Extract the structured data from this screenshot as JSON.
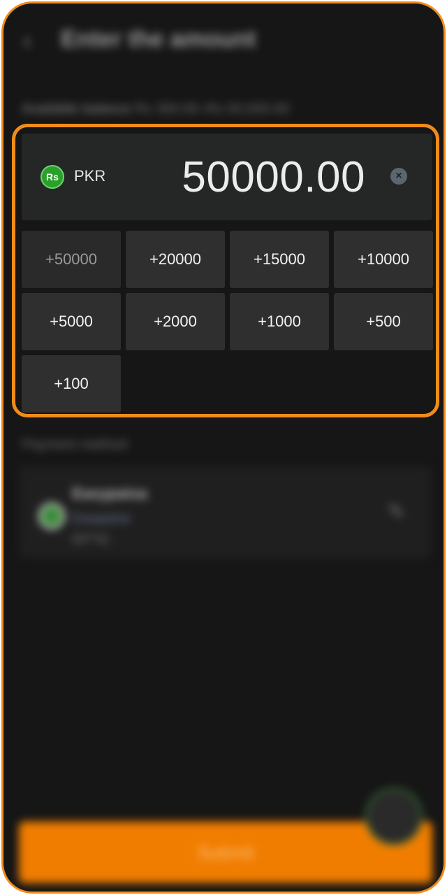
{
  "header": {
    "title": "Enter the amount"
  },
  "balance": {
    "label": "Available balance",
    "value": "Rs 300.00–Rs 50,000.00"
  },
  "amount": {
    "currency_icon": "rupee-icon",
    "currency_code": "PKR",
    "value": "50000.00",
    "quick_amounts": [
      "+50000",
      "+20000",
      "+15000",
      "+10000",
      "+5000",
      "+2000",
      "+1000",
      "+500",
      "+100"
    ]
  },
  "payment_method": {
    "label": "Payment method",
    "name": "Easypaisa",
    "type": "Easypaisa",
    "account": "03**41"
  },
  "submit_label": "Submit",
  "colors": {
    "accent": "#f07d00",
    "highlight": "#f08c1a",
    "background": "#161616"
  }
}
